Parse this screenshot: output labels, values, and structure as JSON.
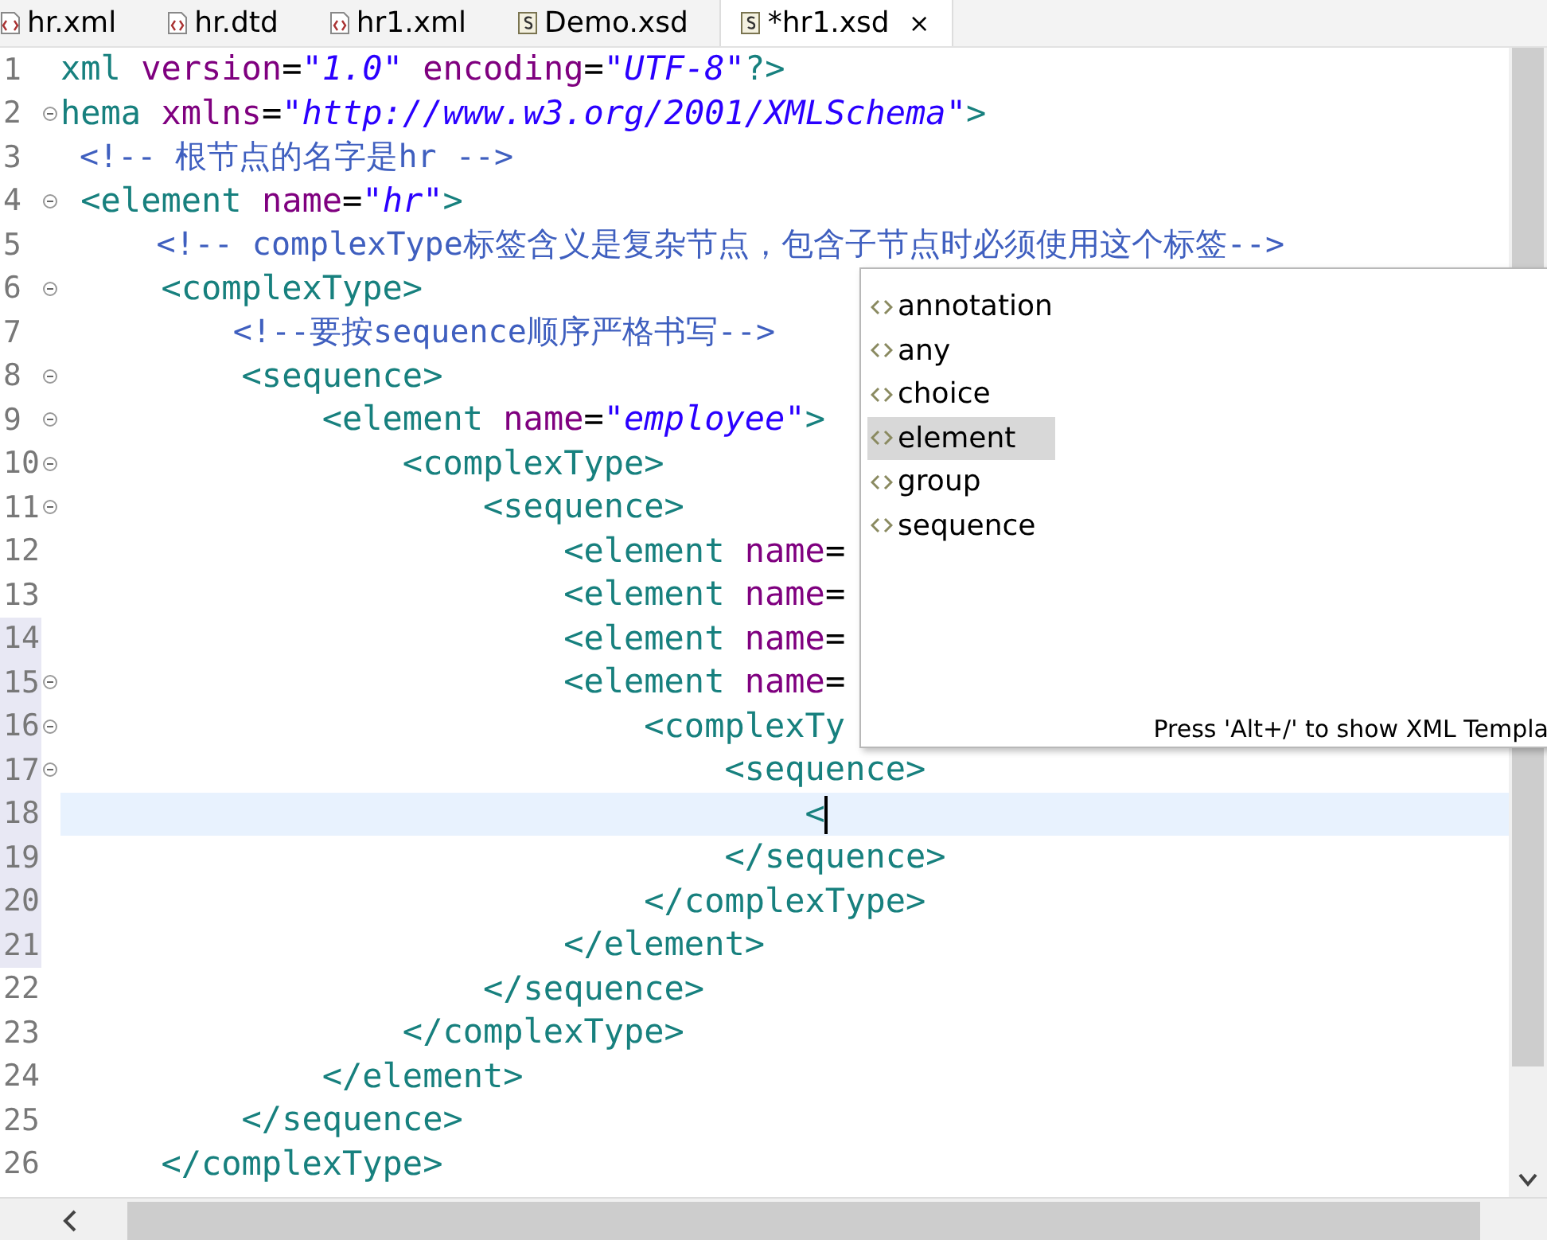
{
  "tabs": [
    {
      "label": "hr.xml",
      "selected": false
    },
    {
      "label": "hr.dtd",
      "selected": false
    },
    {
      "label": "hr1.xml",
      "selected": false
    },
    {
      "label": "Demo.xsd",
      "selected": false
    },
    {
      "label": "*hr1.xsd",
      "selected": true,
      "close": "×"
    }
  ],
  "editor": {
    "lines": [
      {
        "number": "1",
        "foldable": false,
        "changed": false,
        "current": false,
        "tokens": [
          {
            "kind": "tag",
            "text": "xml "
          },
          {
            "kind": "attr",
            "text": "version"
          },
          {
            "kind": "plain",
            "text": "="
          },
          {
            "kind": "value",
            "text": "\"1.0\" "
          },
          {
            "kind": "attr",
            "text": "encoding"
          },
          {
            "kind": "plain",
            "text": "="
          },
          {
            "kind": "value",
            "text": "\"UTF-8\""
          },
          {
            "kind": "tag",
            "text": "?>"
          }
        ]
      },
      {
        "number": "2",
        "foldable": true,
        "changed": false,
        "current": false,
        "tokens": [
          {
            "kind": "tag",
            "text": "hema "
          },
          {
            "kind": "attr",
            "text": "xmlns"
          },
          {
            "kind": "plain",
            "text": "="
          },
          {
            "kind": "value",
            "text": "\"http://www.w3.org/2001/XMLSchema\""
          },
          {
            "kind": "tag",
            "text": ">"
          }
        ]
      },
      {
        "number": "3",
        "foldable": false,
        "changed": false,
        "current": false,
        "tokens": [
          {
            "kind": "comment",
            "text": " <!-- 根节点的名字是hr -->"
          }
        ]
      },
      {
        "number": "4",
        "foldable": true,
        "changed": false,
        "current": false,
        "tokens": [
          {
            "kind": "tag",
            "text": " <element "
          },
          {
            "kind": "attr",
            "text": "name"
          },
          {
            "kind": "plain",
            "text": "="
          },
          {
            "kind": "value",
            "text": "\"hr\""
          },
          {
            "kind": "tag",
            "text": ">"
          }
        ]
      },
      {
        "number": "5",
        "foldable": false,
        "changed": false,
        "current": false,
        "tokens": [
          {
            "kind": "comment",
            "text": "     <!-- complexType标签含义是复杂节点，包含子节点时必须使用这个标签-->"
          }
        ]
      },
      {
        "number": "6",
        "foldable": true,
        "changed": false,
        "current": false,
        "tokens": [
          {
            "kind": "tag",
            "text": "     <complexType>"
          }
        ]
      },
      {
        "number": "7",
        "foldable": false,
        "changed": false,
        "current": false,
        "tokens": [
          {
            "kind": "comment",
            "text": "         <!--要按sequence顺序严格书写-->"
          }
        ]
      },
      {
        "number": "8",
        "foldable": true,
        "changed": false,
        "current": false,
        "tokens": [
          {
            "kind": "tag",
            "text": "         <sequence>"
          }
        ]
      },
      {
        "number": "9",
        "foldable": true,
        "changed": false,
        "current": false,
        "tokens": [
          {
            "kind": "tag",
            "text": "             <element "
          },
          {
            "kind": "attr",
            "text": "name"
          },
          {
            "kind": "plain",
            "text": "="
          },
          {
            "kind": "value",
            "text": "\"employee\""
          },
          {
            "kind": "tag",
            "text": ">"
          }
        ]
      },
      {
        "number": "10",
        "foldable": true,
        "changed": false,
        "current": false,
        "tokens": [
          {
            "kind": "tag",
            "text": "                 <complexType>"
          }
        ]
      },
      {
        "number": "11",
        "foldable": true,
        "changed": false,
        "current": false,
        "tokens": [
          {
            "kind": "tag",
            "text": "                     <sequence>"
          }
        ]
      },
      {
        "number": "12",
        "foldable": false,
        "changed": false,
        "current": false,
        "tokens": [
          {
            "kind": "tag",
            "text": "                         <element "
          },
          {
            "kind": "attr",
            "text": "name"
          },
          {
            "kind": "plain",
            "text": "="
          }
        ]
      },
      {
        "number": "13",
        "foldable": false,
        "changed": false,
        "current": false,
        "tokens": [
          {
            "kind": "tag",
            "text": "                         <element "
          },
          {
            "kind": "attr",
            "text": "name"
          },
          {
            "kind": "plain",
            "text": "="
          }
        ]
      },
      {
        "number": "14",
        "foldable": false,
        "changed": true,
        "current": false,
        "tokens": [
          {
            "kind": "tag",
            "text": "                         <element "
          },
          {
            "kind": "attr",
            "text": "name"
          },
          {
            "kind": "plain",
            "text": "="
          }
        ]
      },
      {
        "number": "15",
        "foldable": true,
        "changed": true,
        "current": false,
        "tokens": [
          {
            "kind": "tag",
            "text": "                         <element "
          },
          {
            "kind": "attr",
            "text": "name"
          },
          {
            "kind": "plain",
            "text": "="
          }
        ]
      },
      {
        "number": "16",
        "foldable": true,
        "changed": true,
        "current": false,
        "tokens": [
          {
            "kind": "tag",
            "text": "                             <complexTy"
          }
        ]
      },
      {
        "number": "17",
        "foldable": true,
        "changed": true,
        "current": false,
        "tokens": [
          {
            "kind": "tag",
            "text": "                                 <sequence>"
          }
        ]
      },
      {
        "number": "18",
        "foldable": false,
        "changed": true,
        "current": true,
        "tokens": [
          {
            "kind": "tag",
            "text": "                                     <"
          }
        ]
      },
      {
        "number": "19",
        "foldable": false,
        "changed": true,
        "current": false,
        "tokens": [
          {
            "kind": "tag",
            "text": "                                 </sequence>"
          }
        ]
      },
      {
        "number": "20",
        "foldable": false,
        "changed": true,
        "current": false,
        "tokens": [
          {
            "kind": "tag",
            "text": "                             </complexType>"
          }
        ]
      },
      {
        "number": "21",
        "foldable": false,
        "changed": true,
        "current": false,
        "tokens": [
          {
            "kind": "tag",
            "text": "                         </element>"
          }
        ]
      },
      {
        "number": "22",
        "foldable": false,
        "changed": false,
        "current": false,
        "tokens": [
          {
            "kind": "tag",
            "text": "                     </sequence>"
          }
        ]
      },
      {
        "number": "23",
        "foldable": false,
        "changed": false,
        "current": false,
        "tokens": [
          {
            "kind": "tag",
            "text": "                 </complexType>"
          }
        ]
      },
      {
        "number": "24",
        "foldable": false,
        "changed": false,
        "current": false,
        "tokens": [
          {
            "kind": "tag",
            "text": "             </element>"
          }
        ]
      },
      {
        "number": "25",
        "foldable": false,
        "changed": false,
        "current": false,
        "tokens": [
          {
            "kind": "tag",
            "text": "         </sequence>"
          }
        ]
      },
      {
        "number": "26",
        "foldable": false,
        "changed": false,
        "current": false,
        "tokens": [
          {
            "kind": "tag",
            "text": "     </complexType>"
          }
        ]
      }
    ]
  },
  "completion_popup": {
    "items": [
      {
        "label": "annotation",
        "selected": false
      },
      {
        "label": "any",
        "selected": false
      },
      {
        "label": "choice",
        "selected": false
      },
      {
        "label": "element",
        "selected": true
      },
      {
        "label": "group",
        "selected": false
      },
      {
        "label": "sequence",
        "selected": false
      }
    ],
    "hint": "Press 'Alt+/' to show XML Templa"
  }
}
